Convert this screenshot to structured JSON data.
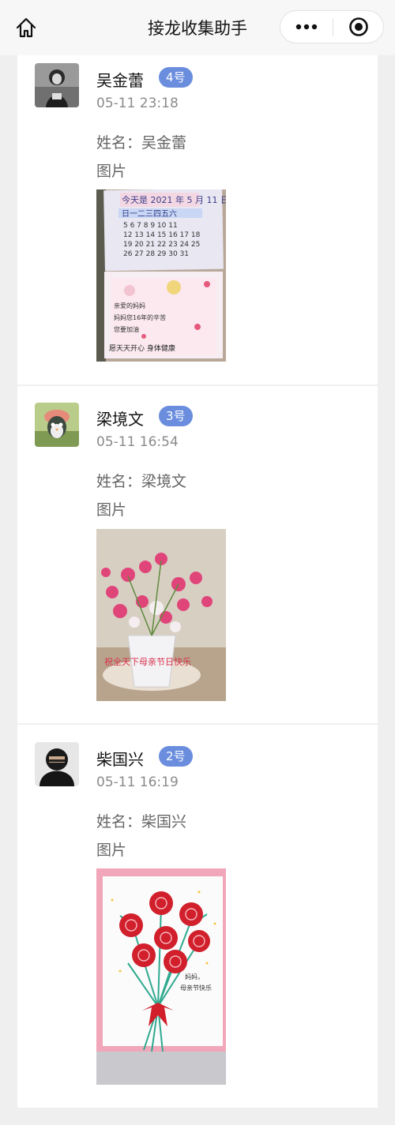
{
  "header": {
    "title": "接龙收集助手"
  },
  "entries": [
    {
      "name": "吴金蕾",
      "badge": "4号",
      "time": "05-11 23:18",
      "name_line": "姓名：吴金蕾",
      "photo_label": "图片",
      "photo_text": [
        "今天是",
        "年",
        "月",
        "日",
        "日一二三四五六",
        "妈妈您16年的辛苦",
        "愿天天开心 身体健康"
      ]
    },
    {
      "name": "梁境文",
      "badge": "3号",
      "time": "05-11 16:54",
      "name_line": "姓名：梁境文",
      "photo_label": "图片",
      "photo_text": [
        "祝全天下母亲节日快乐"
      ]
    },
    {
      "name": "柴国兴",
      "badge": "2号",
      "time": "05-11 16:19",
      "name_line": "姓名：柴国兴",
      "photo_label": "图片",
      "photo_text": [
        "妈妈，",
        "母亲节快乐"
      ]
    }
  ],
  "colors": {
    "badge": "#6a8dde",
    "background": "#efefef"
  },
  "icons": {
    "home": "home-icon",
    "more": "more-dots-icon",
    "close": "target-circle-icon"
  }
}
